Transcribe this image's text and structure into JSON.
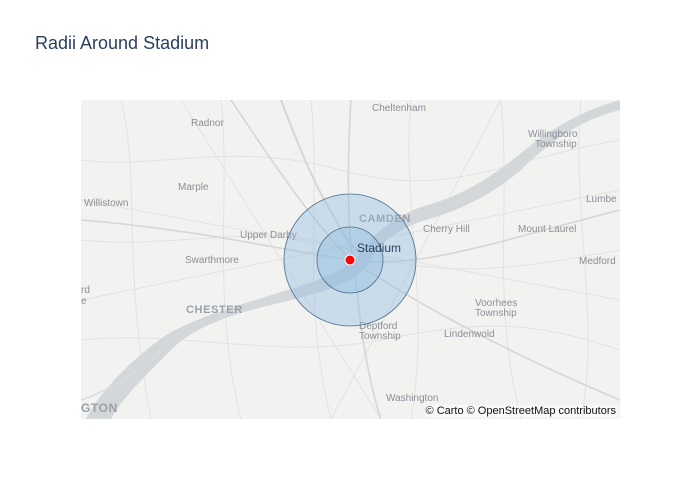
{
  "title": "Radii Around Stadium",
  "marker": {
    "label": "Stadium",
    "color": "#ff0000"
  },
  "rings": {
    "fill": "#8fbbe0",
    "stroke": "#4a6f8f"
  },
  "map_labels": {
    "cheltenham": "Cheltenham",
    "radnor": "Radnor",
    "willingboro": "Willingboro",
    "willingboro_twp": "Township",
    "marple": "Marple",
    "willistown": "Willistown",
    "lumberton": "Lumbe",
    "camden": "CAMDEN",
    "cherry_hill": "Cherry Hill",
    "mount_laurel": "Mount Laurel",
    "upper_darby": "Upper Darby",
    "swarthmore": "Swarthmore",
    "medford": "Medford",
    "left_rd": "rd",
    "left_e": "e",
    "chester": "CHESTER",
    "voorhees": "Voorhees",
    "voorhees_twp": "Township",
    "deptford": "Deptford",
    "deptford_twp": "Township",
    "lindenwold": "Lindenwold",
    "washington": "Washington",
    "wilmington": "GTON"
  },
  "attribution": "© Carto © OpenStreetMap contributors"
}
